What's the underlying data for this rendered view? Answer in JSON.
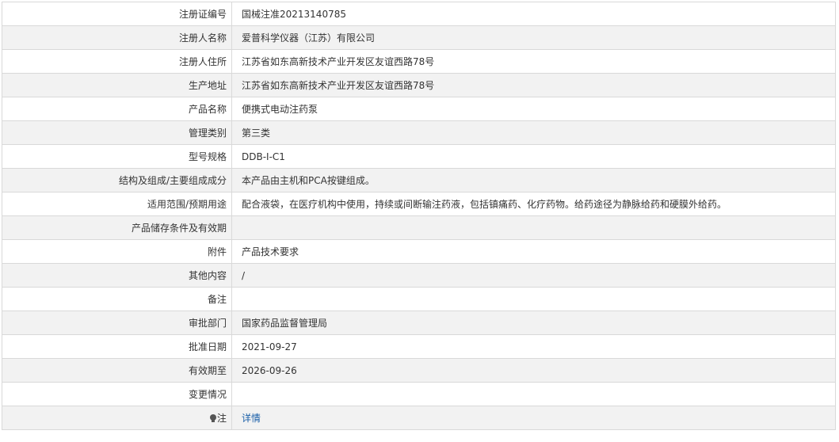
{
  "rows": [
    {
      "label": "注册证编号",
      "value": "国械注准20213140785"
    },
    {
      "label": "注册人名称",
      "value": "爱普科学仪器（江苏）有限公司"
    },
    {
      "label": "注册人住所",
      "value": "江苏省如东高新技术产业开发区友谊西路78号"
    },
    {
      "label": "生产地址",
      "value": "江苏省如东高新技术产业开发区友谊西路78号"
    },
    {
      "label": "产品名称",
      "value": "便携式电动注药泵"
    },
    {
      "label": "管理类别",
      "value": "第三类"
    },
    {
      "label": "型号规格",
      "value": "DDB-Ⅰ-C1"
    },
    {
      "label": "结构及组成/主要组成成分",
      "value": "本产品由主机和PCA按键组成。"
    },
    {
      "label": "适用范围/预期用途",
      "value": "配合液袋，在医疗机构中使用，持续或间断输注药液，包括镇痛药、化疗药物。给药途径为静脉给药和硬膜外给药。"
    },
    {
      "label": "产品储存条件及有效期",
      "value": ""
    },
    {
      "label": "附件",
      "value": "产品技术要求"
    },
    {
      "label": "其他内容",
      "value": "/"
    },
    {
      "label": "备注",
      "value": ""
    },
    {
      "label": "审批部门",
      "value": "国家药品监督管理局"
    },
    {
      "label": "批准日期",
      "value": "2021-09-27"
    },
    {
      "label": "有效期至",
      "value": "2026-09-26"
    },
    {
      "label": "变更情况",
      "value": ""
    }
  ],
  "note_row": {
    "label": "注",
    "link_text": "详情",
    "icon": "lightbulb-icon"
  },
  "colors": {
    "row_alt_background": "#f2f2f2",
    "border": "#d9d9d9",
    "text": "#333333",
    "link": "#1a5fa8"
  }
}
